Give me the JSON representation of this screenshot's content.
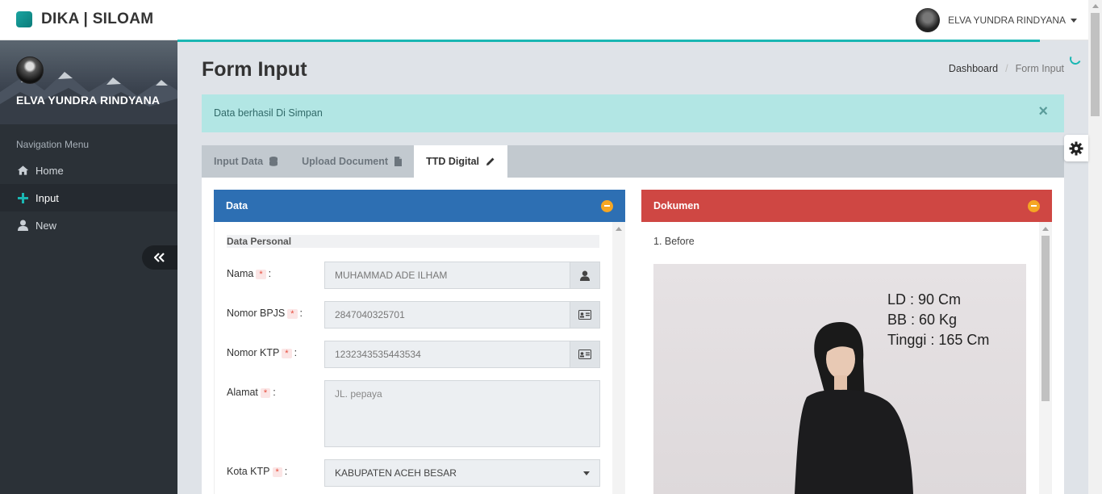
{
  "brand": {
    "title": "DIKA | SILOAM"
  },
  "topbar": {
    "user_name": "ELVA YUNDRA RINDYANA"
  },
  "sidebar": {
    "profile_name": "ELVA YUNDRA RINDYANA",
    "nav_header": "Navigation Menu",
    "items": [
      {
        "label": "Home",
        "icon": "home-icon"
      },
      {
        "label": "Input",
        "icon": "plus-icon"
      },
      {
        "label": "New",
        "icon": "user-icon"
      }
    ]
  },
  "page": {
    "title": "Form Input",
    "breadcrumb": [
      "Dashboard",
      "Form Input"
    ]
  },
  "alert": {
    "message": "Data berhasil Di Simpan",
    "close": "×"
  },
  "tabs": [
    {
      "label": "Input Data",
      "icon": "database-icon"
    },
    {
      "label": "Upload Document",
      "icon": "file-icon"
    },
    {
      "label": "TTD Digital",
      "icon": "pencil-icon"
    }
  ],
  "data_panel": {
    "title": "Data",
    "section": "Data Personal",
    "req_mark": "*",
    "fields": {
      "nama": {
        "label": "Nama",
        "value": "MUHAMMAD ADE ILHAM"
      },
      "bpjs": {
        "label": "Nomor BPJS",
        "value": "2847040325701"
      },
      "ktp": {
        "label": "Nomor KTP",
        "value": "1232343535443534"
      },
      "alamat": {
        "label": "Alamat",
        "value": "JL. pepaya"
      },
      "kota": {
        "label": "Kota KTP",
        "value": "KABUPATEN ACEH BESAR"
      }
    }
  },
  "doc_panel": {
    "title": "Dokumen",
    "item_label": "1. Before",
    "photo_text": [
      "LD : 90 Cm",
      "BB : 60 Kg",
      "Tinggi : 165 Cm"
    ]
  },
  "colors": {
    "accent": "#1ab7b3",
    "data_header": "#2d6fb3",
    "doc_header": "#cf4743",
    "sidebar": "#2b3137"
  }
}
